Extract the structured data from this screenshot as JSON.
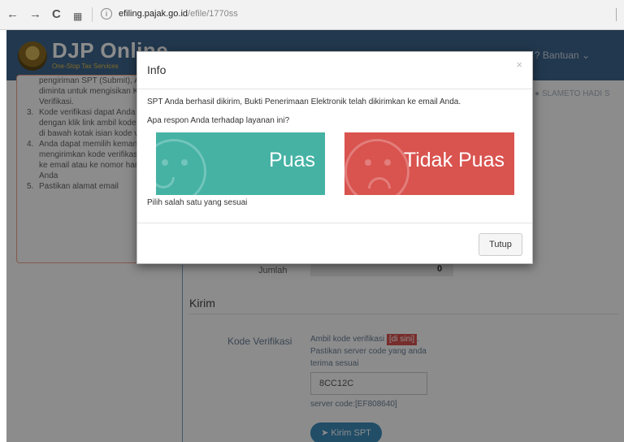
{
  "browser": {
    "url_host": "efiling.pajak.go.id",
    "url_path": "/efile/1770ss",
    "back_icon": "arrow-left-icon",
    "forward_icon": "arrow-right-icon",
    "reload_icon": "reload-icon",
    "apps_icon": "apps-grid-icon"
  },
  "app": {
    "brand": "DJP Online",
    "tagline": "One-Stop Tax Services",
    "help_label": "Bantuan",
    "user_label": "SLAMETO HADI S",
    "header_color": "#3f678f"
  },
  "sidebar": {
    "item2_tail": "pengiriman SPT (Submit), Anda diminta untuk mengisikan Kode Verifikasi.",
    "items": [
      {
        "num": "3.",
        "text": "Kode verifikasi dapat Anda minta dengan klik link ambil kode verifikasi di bawah kotak isian kode verifikasi"
      },
      {
        "num": "4.",
        "text": "Anda dapat memilih kemana sistem mengirimkan kode verifikasi, apakah ke email atau ke nomor handphone Anda"
      },
      {
        "num": "5.",
        "text": "Pastikan alamat email"
      }
    ]
  },
  "main": {
    "jumlah_label": "Jumlah",
    "jumlah_value": "0",
    "section_title": "Kirim",
    "kode_label": "Kode Verifikasi",
    "help_prefix": "Ambil kode verifikasi",
    "help_link": "[di sini]",
    "help_suffix": ". Pastikan server code yang anda terima sesuai",
    "code_value": "8CC12C",
    "server_code": "server code:[EF808640]",
    "send_label": "Kirim SPT"
  },
  "modal": {
    "title": "Info",
    "close_icon": "×",
    "message": "SPT Anda berhasil dikirim, Bukti Penerimaan Elektronik telah dikirimkan ke email Anda.",
    "question": "Apa respon Anda terhadap layanan ini?",
    "choice_positive": "Puas",
    "choice_negative": "Tidak Puas",
    "hint": "Pilih salah satu yang sesuai",
    "close_label": "Tutup",
    "positive_color": "#45b2a4",
    "negative_color": "#d9534f"
  }
}
